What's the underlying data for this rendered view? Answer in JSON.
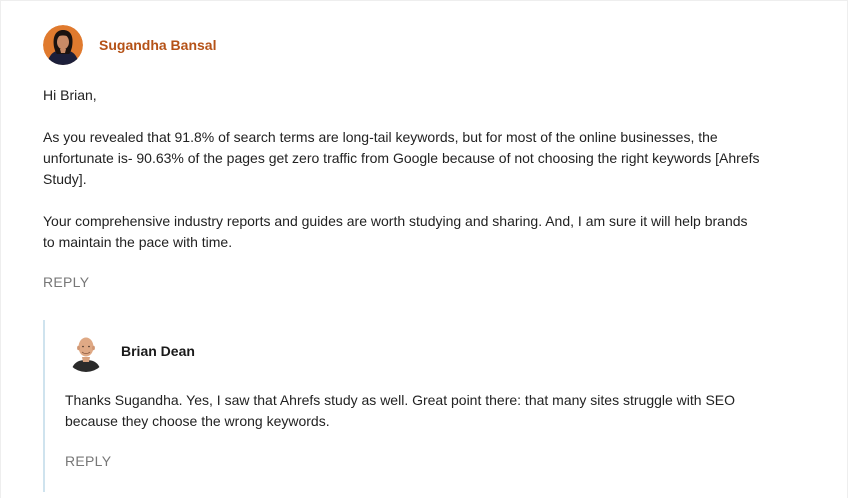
{
  "comment": {
    "author": "Sugandha Bansal",
    "avatar_icon": "avatar-woman",
    "paragraphs": [
      "Hi Brian,",
      "As you revealed that 91.8% of search terms are long-tail keywords, but for most of the online businesses, the unfortunate is- 90.63% of the pages get zero traffic from Google because of not choosing the right keywords [Ahrefs Study].",
      "Your comprehensive industry reports and guides are worth studying and sharing. And, I am sure it will help brands to maintain the pace with time."
    ],
    "reply_label": "REPLY"
  },
  "reply": {
    "author": "Brian Dean",
    "avatar_icon": "avatar-man",
    "paragraphs": [
      "Thanks Sugandha. Yes, I saw that Ahrefs study as well. Great point there: that many sites struggle with SEO because they choose the wrong keywords."
    ],
    "reply_label": "REPLY"
  },
  "colors": {
    "author_accent": "#b55217",
    "thread_line": "#cfe3ee",
    "reply_link": "#777777"
  }
}
